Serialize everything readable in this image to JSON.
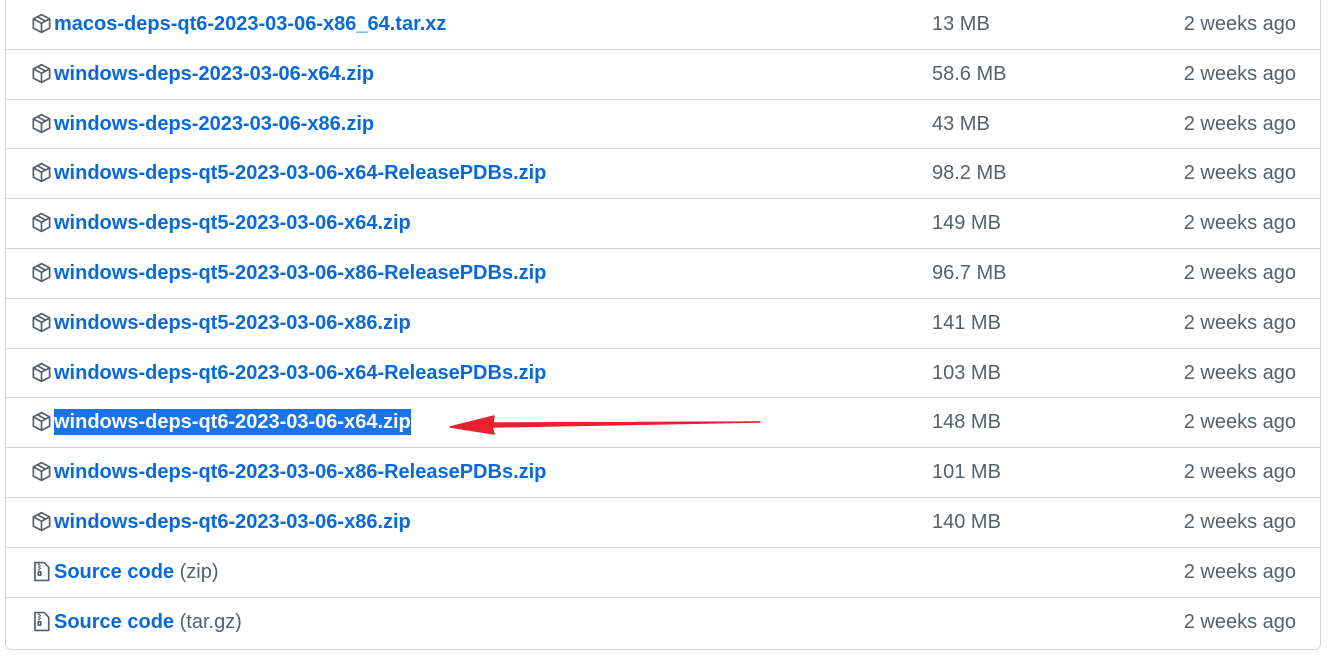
{
  "assets": [
    {
      "name": "macos-deps-qt6-2023-03-06-x86_64.tar.xz",
      "suffix": "",
      "size": "13 MB",
      "date": "2 weeks ago",
      "icon": "package-icon",
      "selected": false
    },
    {
      "name": "windows-deps-2023-03-06-x64.zip",
      "suffix": "",
      "size": "58.6 MB",
      "date": "2 weeks ago",
      "icon": "package-icon",
      "selected": false
    },
    {
      "name": "windows-deps-2023-03-06-x86.zip",
      "suffix": "",
      "size": "43 MB",
      "date": "2 weeks ago",
      "icon": "package-icon",
      "selected": false
    },
    {
      "name": "windows-deps-qt5-2023-03-06-x64-ReleasePDBs.zip",
      "suffix": "",
      "size": "98.2 MB",
      "date": "2 weeks ago",
      "icon": "package-icon",
      "selected": false
    },
    {
      "name": "windows-deps-qt5-2023-03-06-x64.zip",
      "suffix": "",
      "size": "149 MB",
      "date": "2 weeks ago",
      "icon": "package-icon",
      "selected": false
    },
    {
      "name": "windows-deps-qt5-2023-03-06-x86-ReleasePDBs.zip",
      "suffix": "",
      "size": "96.7 MB",
      "date": "2 weeks ago",
      "icon": "package-icon",
      "selected": false
    },
    {
      "name": "windows-deps-qt5-2023-03-06-x86.zip",
      "suffix": "",
      "size": "141 MB",
      "date": "2 weeks ago",
      "icon": "package-icon",
      "selected": false
    },
    {
      "name": "windows-deps-qt6-2023-03-06-x64-ReleasePDBs.zip",
      "suffix": "",
      "size": "103 MB",
      "date": "2 weeks ago",
      "icon": "package-icon",
      "selected": false
    },
    {
      "name": "windows-deps-qt6-2023-03-06-x64.zip",
      "suffix": "",
      "size": "148 MB",
      "date": "2 weeks ago",
      "icon": "package-icon",
      "selected": true
    },
    {
      "name": "windows-deps-qt6-2023-03-06-x86-ReleasePDBs.zip",
      "suffix": "",
      "size": "101 MB",
      "date": "2 weeks ago",
      "icon": "package-icon",
      "selected": false
    },
    {
      "name": "windows-deps-qt6-2023-03-06-x86.zip",
      "suffix": "",
      "size": "140 MB",
      "date": "2 weeks ago",
      "icon": "package-icon",
      "selected": false
    },
    {
      "name": "Source code",
      "suffix": "(zip)",
      "size": "",
      "date": "2 weeks ago",
      "icon": "file-zip-icon",
      "selected": false
    },
    {
      "name": "Source code",
      "suffix": "(tar.gz)",
      "size": "",
      "date": "2 weeks ago",
      "icon": "file-zip-icon",
      "selected": false
    }
  ],
  "colors": {
    "link": "#0969da",
    "muted": "#57606a",
    "border": "#d0d7de",
    "selection": "#1a73e8",
    "annotation_arrow": "#e8222d"
  }
}
